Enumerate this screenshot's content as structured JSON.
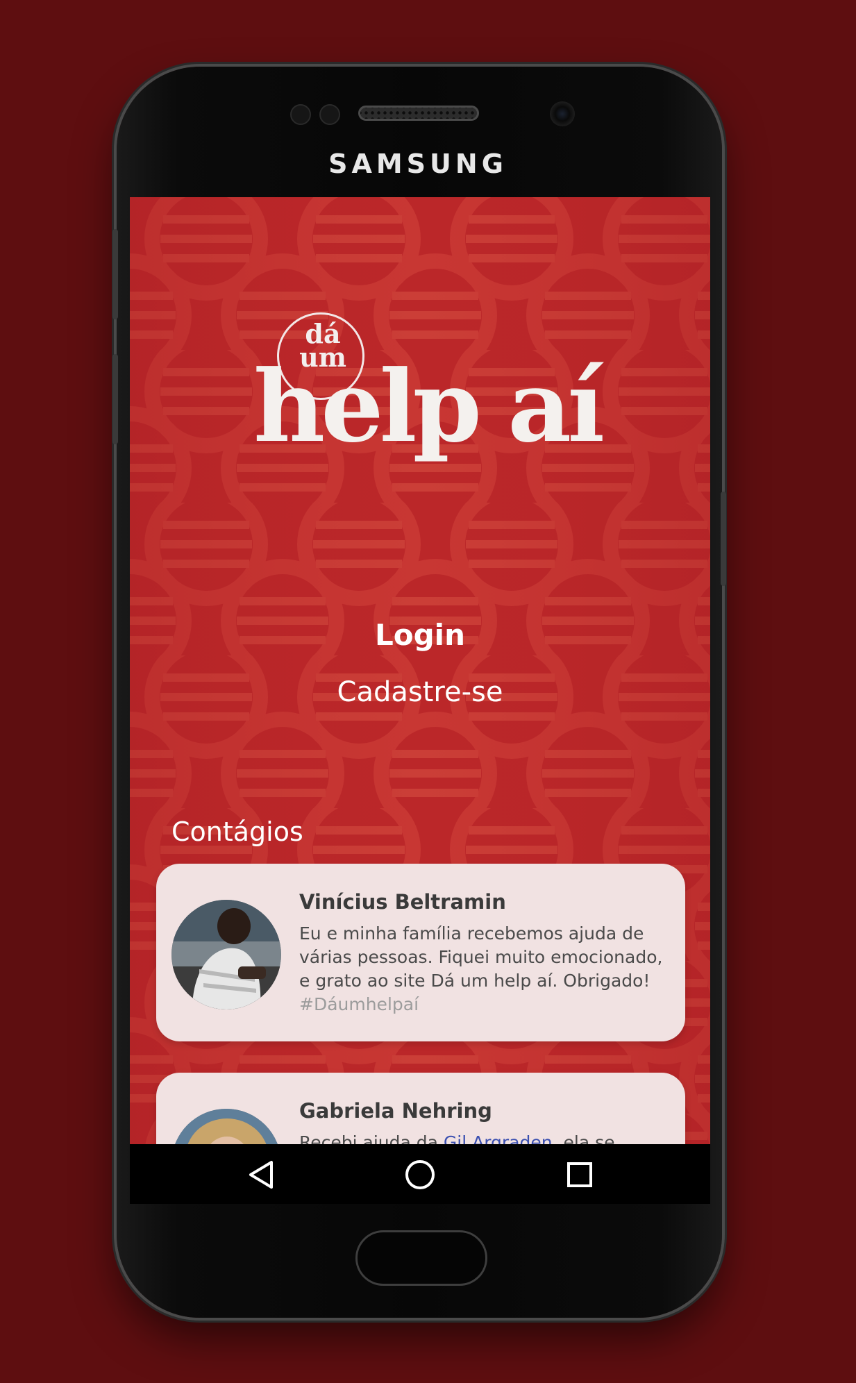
{
  "device": {
    "brand": "SAMSUNG"
  },
  "logo": {
    "small_text_line1": "dá",
    "small_text_line2": "um",
    "big_text": "help aí"
  },
  "auth": {
    "login_label": "Login",
    "signup_label": "Cadastre-se"
  },
  "section": {
    "title": "Contágios"
  },
  "testimonials": [
    {
      "name": "Vinícius Beltramin",
      "text": "Eu e minha família recebemos ajuda de várias pessoas. Fiquei muito emocionado, e grato ao site Dá um help aí. Obrigado!",
      "hashtag": "#Dáumhelpaí"
    },
    {
      "name": "Gabriela Nehring",
      "text_before": "Recebi ajuda da",
      "mention": "Gil Argraden",
      "text_after": ", ela se"
    }
  ],
  "colors": {
    "background": "#5e0e10",
    "screen_red": "#b8262a",
    "card": "#f1e2e2",
    "mention": "#3a4fb0",
    "hashtag": "#9c9c9c"
  },
  "icons": {
    "nav_back": "triangle-back-icon",
    "nav_home": "circle-home-icon",
    "nav_recent": "square-recent-icon"
  }
}
